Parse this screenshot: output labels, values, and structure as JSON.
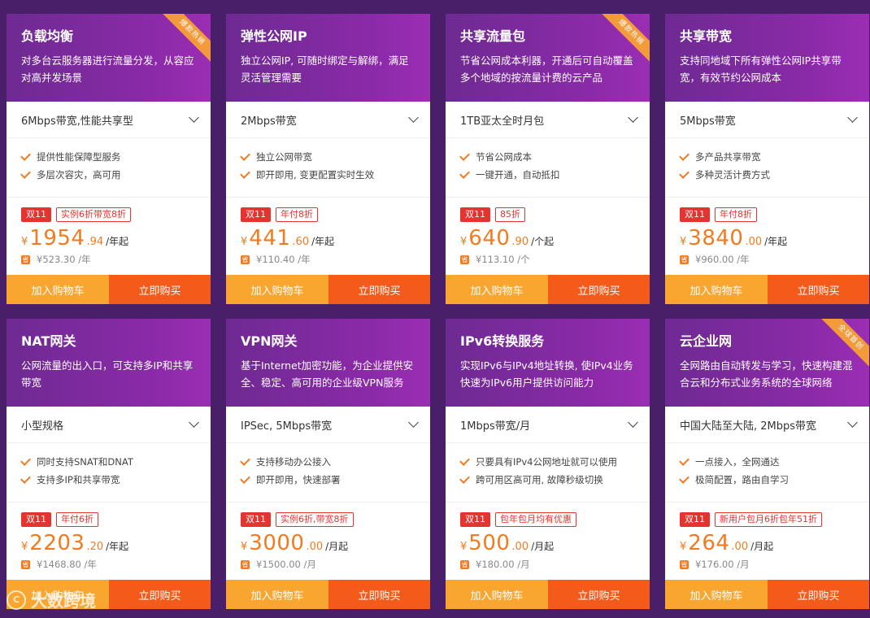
{
  "watermark": {
    "logo": "C",
    "text": "大数跨境"
  },
  "products": [
    {
      "title": "负载均衡",
      "desc": "对多台云服务器进行流量分发，从容应对高并发场景",
      "ribbon": "爆款热销",
      "spec": "6Mbps带宽,性能共享型",
      "features": [
        "提供性能保障型服务",
        "多层次容灾，高可用"
      ],
      "badge": "双11",
      "discount": "实例6折带宽8折",
      "yen": "¥",
      "price_int": "1954",
      "price_dec": ".94",
      "unit": "/年起",
      "save_icon": "省",
      "original": "¥523.30 /年",
      "cart": "加入购物车",
      "buy": "立即购买"
    },
    {
      "title": "弹性公网IP",
      "desc": "独立公网IP, 可随时绑定与解绑，满足灵活管理需要",
      "ribbon": "",
      "spec": "2Mbps带宽",
      "features": [
        "独立公网带宽",
        "即开即用, 变更配置实时生效"
      ],
      "badge": "双11",
      "discount": "年付8折",
      "yen": "¥",
      "price_int": "441",
      "price_dec": ".60",
      "unit": "/年起",
      "save_icon": "省",
      "original": "¥110.40 /年",
      "cart": "加入购物车",
      "buy": "立即购买"
    },
    {
      "title": "共享流量包",
      "desc": "节省公网成本利器，开通后可自动覆盖多个地域的按流量计费的云产品",
      "ribbon": "爆款热销",
      "spec": "1TB亚太全时月包",
      "features": [
        "节省公网成本",
        "一键开通，自动抵扣"
      ],
      "badge": "双11",
      "discount": "85折",
      "yen": "¥",
      "price_int": "640",
      "price_dec": ".90",
      "unit": "/个起",
      "save_icon": "省",
      "original": "¥113.10 /个",
      "cart": "加入购物车",
      "buy": "立即购买"
    },
    {
      "title": "共享带宽",
      "desc": "支持同地域下所有弹性公网IP共享带宽，有效节约公网成本",
      "ribbon": "",
      "spec": "5Mbps带宽",
      "features": [
        "多产品共享带宽",
        "多种灵活计费方式"
      ],
      "badge": "双11",
      "discount": "年付8折",
      "yen": "¥",
      "price_int": "3840",
      "price_dec": ".00",
      "unit": "/年起",
      "save_icon": "省",
      "original": "¥960.00 /年",
      "cart": "加入购物车",
      "buy": "立即购买"
    },
    {
      "title": "NAT网关",
      "desc": "公网流量的出入口，可支持多IP和共享带宽",
      "ribbon": "",
      "spec": "小型规格",
      "features": [
        "同时支持SNAT和DNAT",
        "支持多IP和共享带宽"
      ],
      "badge": "双11",
      "discount": "年付6折",
      "yen": "¥",
      "price_int": "2203",
      "price_dec": ".20",
      "unit": "/年起",
      "save_icon": "省",
      "original": "¥1468.80 /年",
      "cart": "加入购物车",
      "buy": "立即购买"
    },
    {
      "title": "VPN网关",
      "desc": "基于Internet加密功能，为企业提供安全、稳定、高可用的企业级VPN服务",
      "ribbon": "",
      "spec": "IPSec, 5Mbps带宽",
      "features": [
        "支持移动办公接入",
        "即开即用，快速部署"
      ],
      "badge": "双11",
      "discount": "实例6折,带宽8折",
      "yen": "¥",
      "price_int": "3000",
      "price_dec": ".00",
      "unit": "/月起",
      "save_icon": "省",
      "original": "¥1500.00 /月",
      "cart": "加入购物车",
      "buy": "立即购买"
    },
    {
      "title": "IPv6转换服务",
      "desc": "实现IPv6与IPv4地址转换, 使IPv4业务快速为IPv6用户提供访问能力",
      "ribbon": "",
      "spec": "1Mbps带宽/月",
      "features": [
        "只要具有IPv4公网地址就可以使用",
        "跨可用区高可用, 故障秒级切换"
      ],
      "badge": "双11",
      "discount": "包年包月均有优惠",
      "yen": "¥",
      "price_int": "500",
      "price_dec": ".00",
      "unit": "/月起",
      "save_icon": "省",
      "original": "¥180.00 /月",
      "cart": "加入购物车",
      "buy": "立即购买"
    },
    {
      "title": "云企业网",
      "desc": "全网路由自动转发与学习，快速构建混合云和分布式业务系统的全球网络",
      "ribbon": "全球首创",
      "spec": "中国大陆至大陆, 2Mbps带宽",
      "features": [
        "一点接入，全网通达",
        "极简配置，路由自学习"
      ],
      "badge": "双11",
      "discount": "新用户包月6折包年51折",
      "yen": "¥",
      "price_int": "264",
      "price_dec": ".00",
      "unit": "/月起",
      "save_icon": "省",
      "original": "¥176.00 /月",
      "cart": "加入购物车",
      "buy": "立即购买"
    }
  ]
}
